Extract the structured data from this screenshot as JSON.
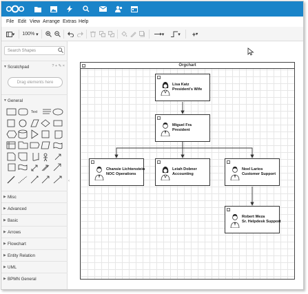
{
  "menubar": {
    "items": [
      "File",
      "Edit",
      "View",
      "Arrange",
      "Extras",
      "Help"
    ]
  },
  "toolbar": {
    "zoom": "100%"
  },
  "sidebar": {
    "search_placeholder": "Search Shapes",
    "scratchpad_label": "Scratchpad",
    "scratchpad_icons": "? + ✎ ×",
    "drag_hint": "Drag elements here",
    "general_label": "General",
    "sections": [
      "Misc",
      "Advanced",
      "Basic",
      "Arrows",
      "Flowchart",
      "Entity Relation",
      "UML",
      "BPMN General"
    ]
  },
  "canvas": {
    "container_title": "Orgchart",
    "nodes": [
      {
        "name": "Lisa Katz",
        "title": "President's Wife",
        "avatar": "female"
      },
      {
        "name": "Miguel Fra",
        "title": "President",
        "avatar": "male"
      },
      {
        "name": "Chansie Lichtenstein",
        "title": "NOC Operations",
        "avatar": "male"
      },
      {
        "name": "Leiah Dobner",
        "title": "Accounting",
        "avatar": "female"
      },
      {
        "name": "Noel Larios",
        "title": "Customer Support",
        "avatar": "male"
      },
      {
        "name": "Robert Meza",
        "title": "Sr. Helpdesk Support",
        "avatar": "male"
      }
    ]
  },
  "colors": {
    "topbar": "#1a84c9",
    "sidebar": "#f5f5f5",
    "grid": "#e6e6e6"
  }
}
